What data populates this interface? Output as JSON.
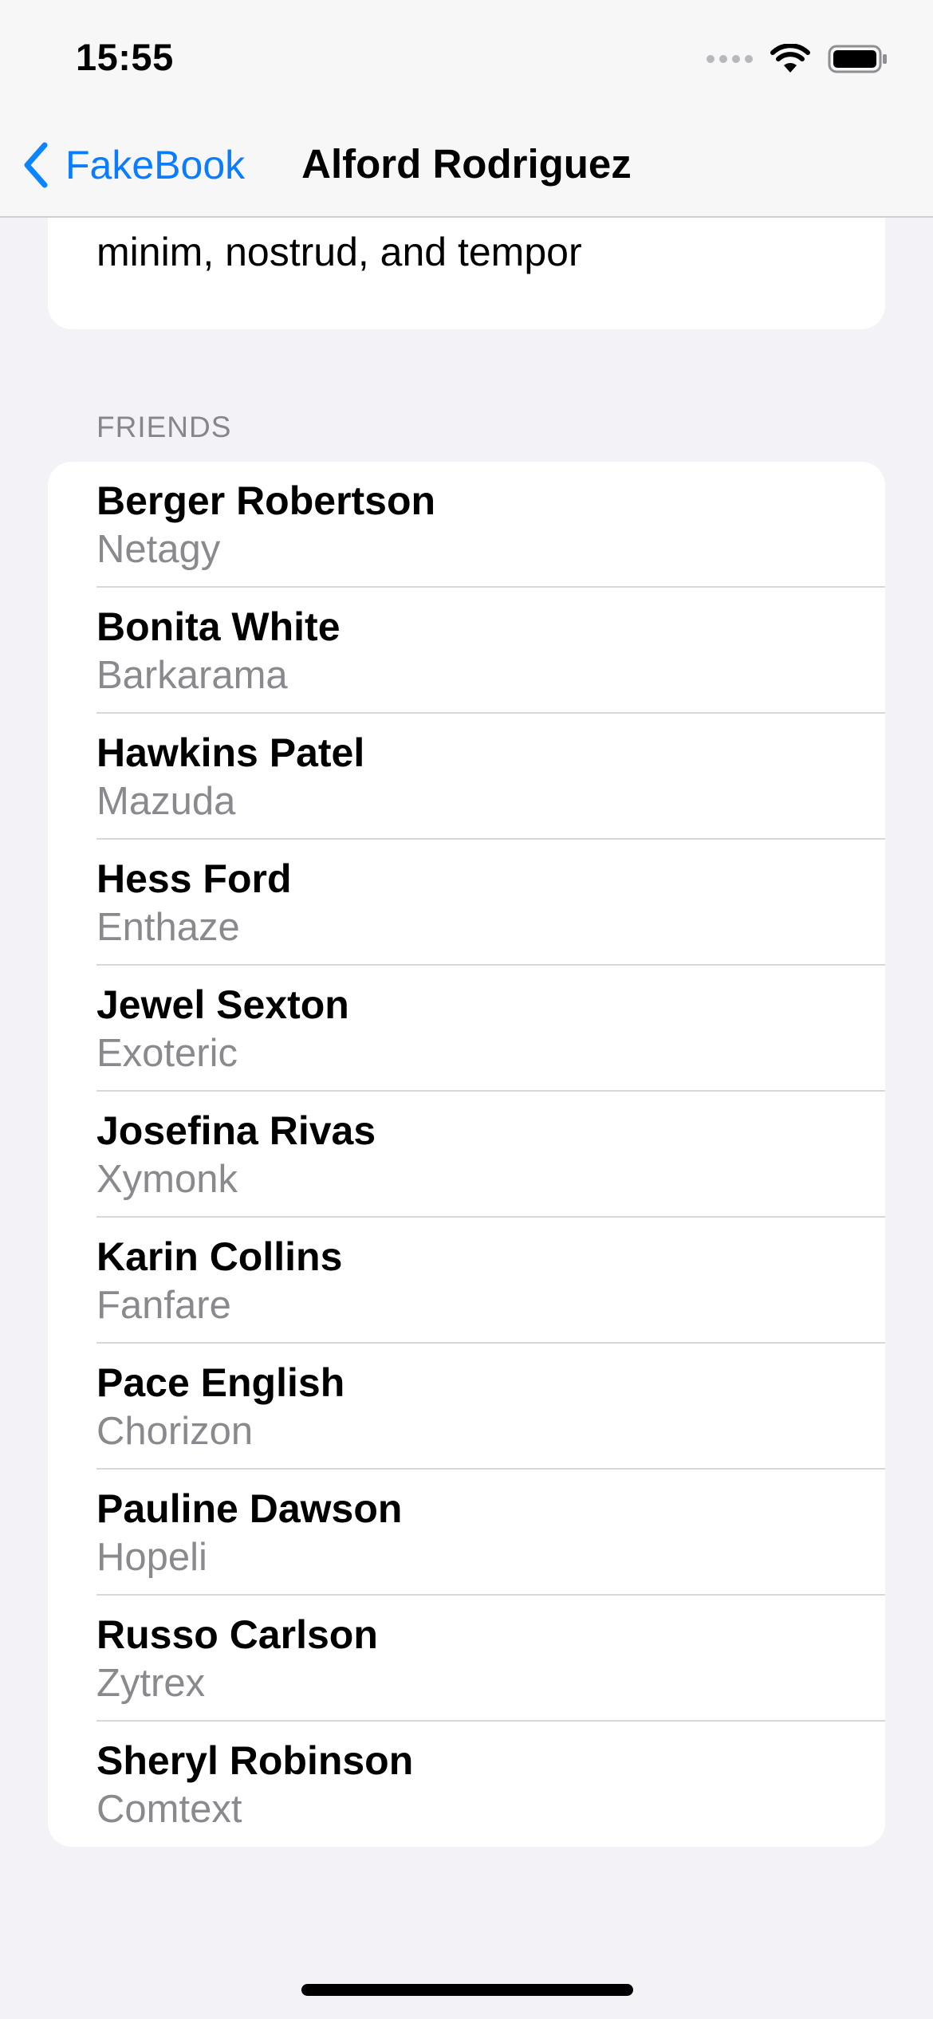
{
  "status_bar": {
    "time": "15:55"
  },
  "nav": {
    "back_label": "FakeBook",
    "title": "Alford Rodriguez"
  },
  "about": {
    "text_visible": "minim, nostrud, and tempor"
  },
  "friends": {
    "header": "FRIENDS",
    "items": [
      {
        "name": "Berger Robertson",
        "company": "Netagy"
      },
      {
        "name": "Bonita White",
        "company": "Barkarama"
      },
      {
        "name": "Hawkins Patel",
        "company": "Mazuda"
      },
      {
        "name": "Hess Ford",
        "company": "Enthaze"
      },
      {
        "name": "Jewel Sexton",
        "company": "Exoteric"
      },
      {
        "name": "Josefina Rivas",
        "company": "Xymonk"
      },
      {
        "name": "Karin Collins",
        "company": "Fanfare"
      },
      {
        "name": "Pace English",
        "company": "Chorizon"
      },
      {
        "name": "Pauline Dawson",
        "company": "Hopeli"
      },
      {
        "name": "Russo Carlson",
        "company": "Zytrex"
      },
      {
        "name": "Sheryl Robinson",
        "company": "Comtext"
      }
    ]
  },
  "icons": {
    "back": "chevron-left-icon",
    "wifi": "wifi-icon",
    "battery": "battery-icon",
    "signal": "cellular-signal-icon"
  },
  "colors": {
    "accent": "#0a84ff",
    "background": "#f2f2f7",
    "secondary_text": "#8a8a8e"
  }
}
